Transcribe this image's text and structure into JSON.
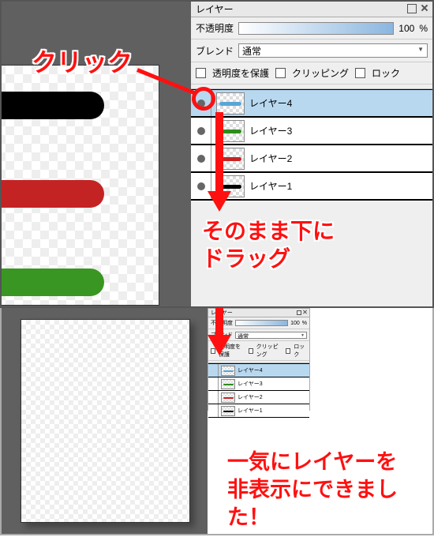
{
  "panel": {
    "title": "レイヤー",
    "opacity_label": "不透明度",
    "opacity_value": "100",
    "opacity_unit": "%",
    "blend_label": "ブレンド",
    "blend_value": "通常",
    "opt_protect": "透明度を保護",
    "opt_clipping": "クリッピング",
    "opt_lock": "ロック"
  },
  "layers": [
    {
      "name": "レイヤー4",
      "stroke_color": "#5aa5d6",
      "selected": true,
      "visible": true
    },
    {
      "name": "レイヤー3",
      "stroke_color": "#2e8b1e",
      "selected": false,
      "visible": true
    },
    {
      "name": "レイヤー2",
      "stroke_color": "#c42323",
      "selected": false,
      "visible": true
    },
    {
      "name": "レイヤー1",
      "stroke_color": "#000000",
      "selected": false,
      "visible": true
    }
  ],
  "annotations": {
    "click": "クリック",
    "drag_down": "そのまま下に\nドラッグ",
    "result": "一気にレイヤーを\n非表示にできました！"
  },
  "colors": {
    "accent_red": "#ff1010",
    "selected_row": "#b8d8f0",
    "canvas_bg": "#606060"
  }
}
